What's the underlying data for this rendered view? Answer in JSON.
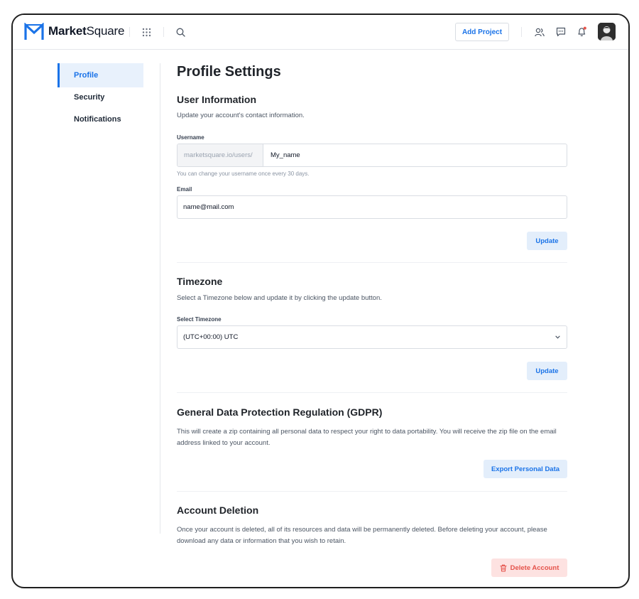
{
  "header": {
    "brand_bold": "Market",
    "brand_light": "Square",
    "add_project_label": "Add Project",
    "icons": [
      "apps-grid-icon",
      "search-icon",
      "users-icon",
      "chat-icon",
      "bell-icon"
    ],
    "notification_dot_color": "#e5534b"
  },
  "sidebar": {
    "items": [
      {
        "label": "Profile",
        "active": true
      },
      {
        "label": "Security",
        "active": false
      },
      {
        "label": "Notifications",
        "active": false
      }
    ]
  },
  "page": {
    "title": "Profile Settings"
  },
  "user_info": {
    "title": "User Information",
    "description": "Update your account's contact information.",
    "username_label": "Username",
    "username_prefix": "marketsquare.io/users/",
    "username_value": "My_name",
    "username_hint": "You can change your username once every 30 days.",
    "email_label": "Email",
    "email_value": "name@mail.com",
    "update_label": "Update"
  },
  "timezone": {
    "title": "Timezone",
    "description": "Select a Timezone below and update it by clicking the update button.",
    "select_label": "Select Timezone",
    "selected_value": "(UTC+00:00) UTC",
    "update_label": "Update"
  },
  "gdpr": {
    "title": "General Data Protection Regulation (GDPR)",
    "description": "This will create a zip containing all personal data to respect your right to data portability. You will receive the zip file on the email address linked to your account.",
    "export_label": "Export Personal Data"
  },
  "deletion": {
    "title": "Account Deletion",
    "description": "Once your account is deleted, all of its resources and data will be permanently deleted. Before deleting your account, please download any data or information that you wish to retain.",
    "delete_label": "Delete Account"
  },
  "colors": {
    "accent": "#1a73e8",
    "accent_soft": "#e3eefb",
    "danger": "#e5534b",
    "danger_soft": "#fde2e1"
  }
}
